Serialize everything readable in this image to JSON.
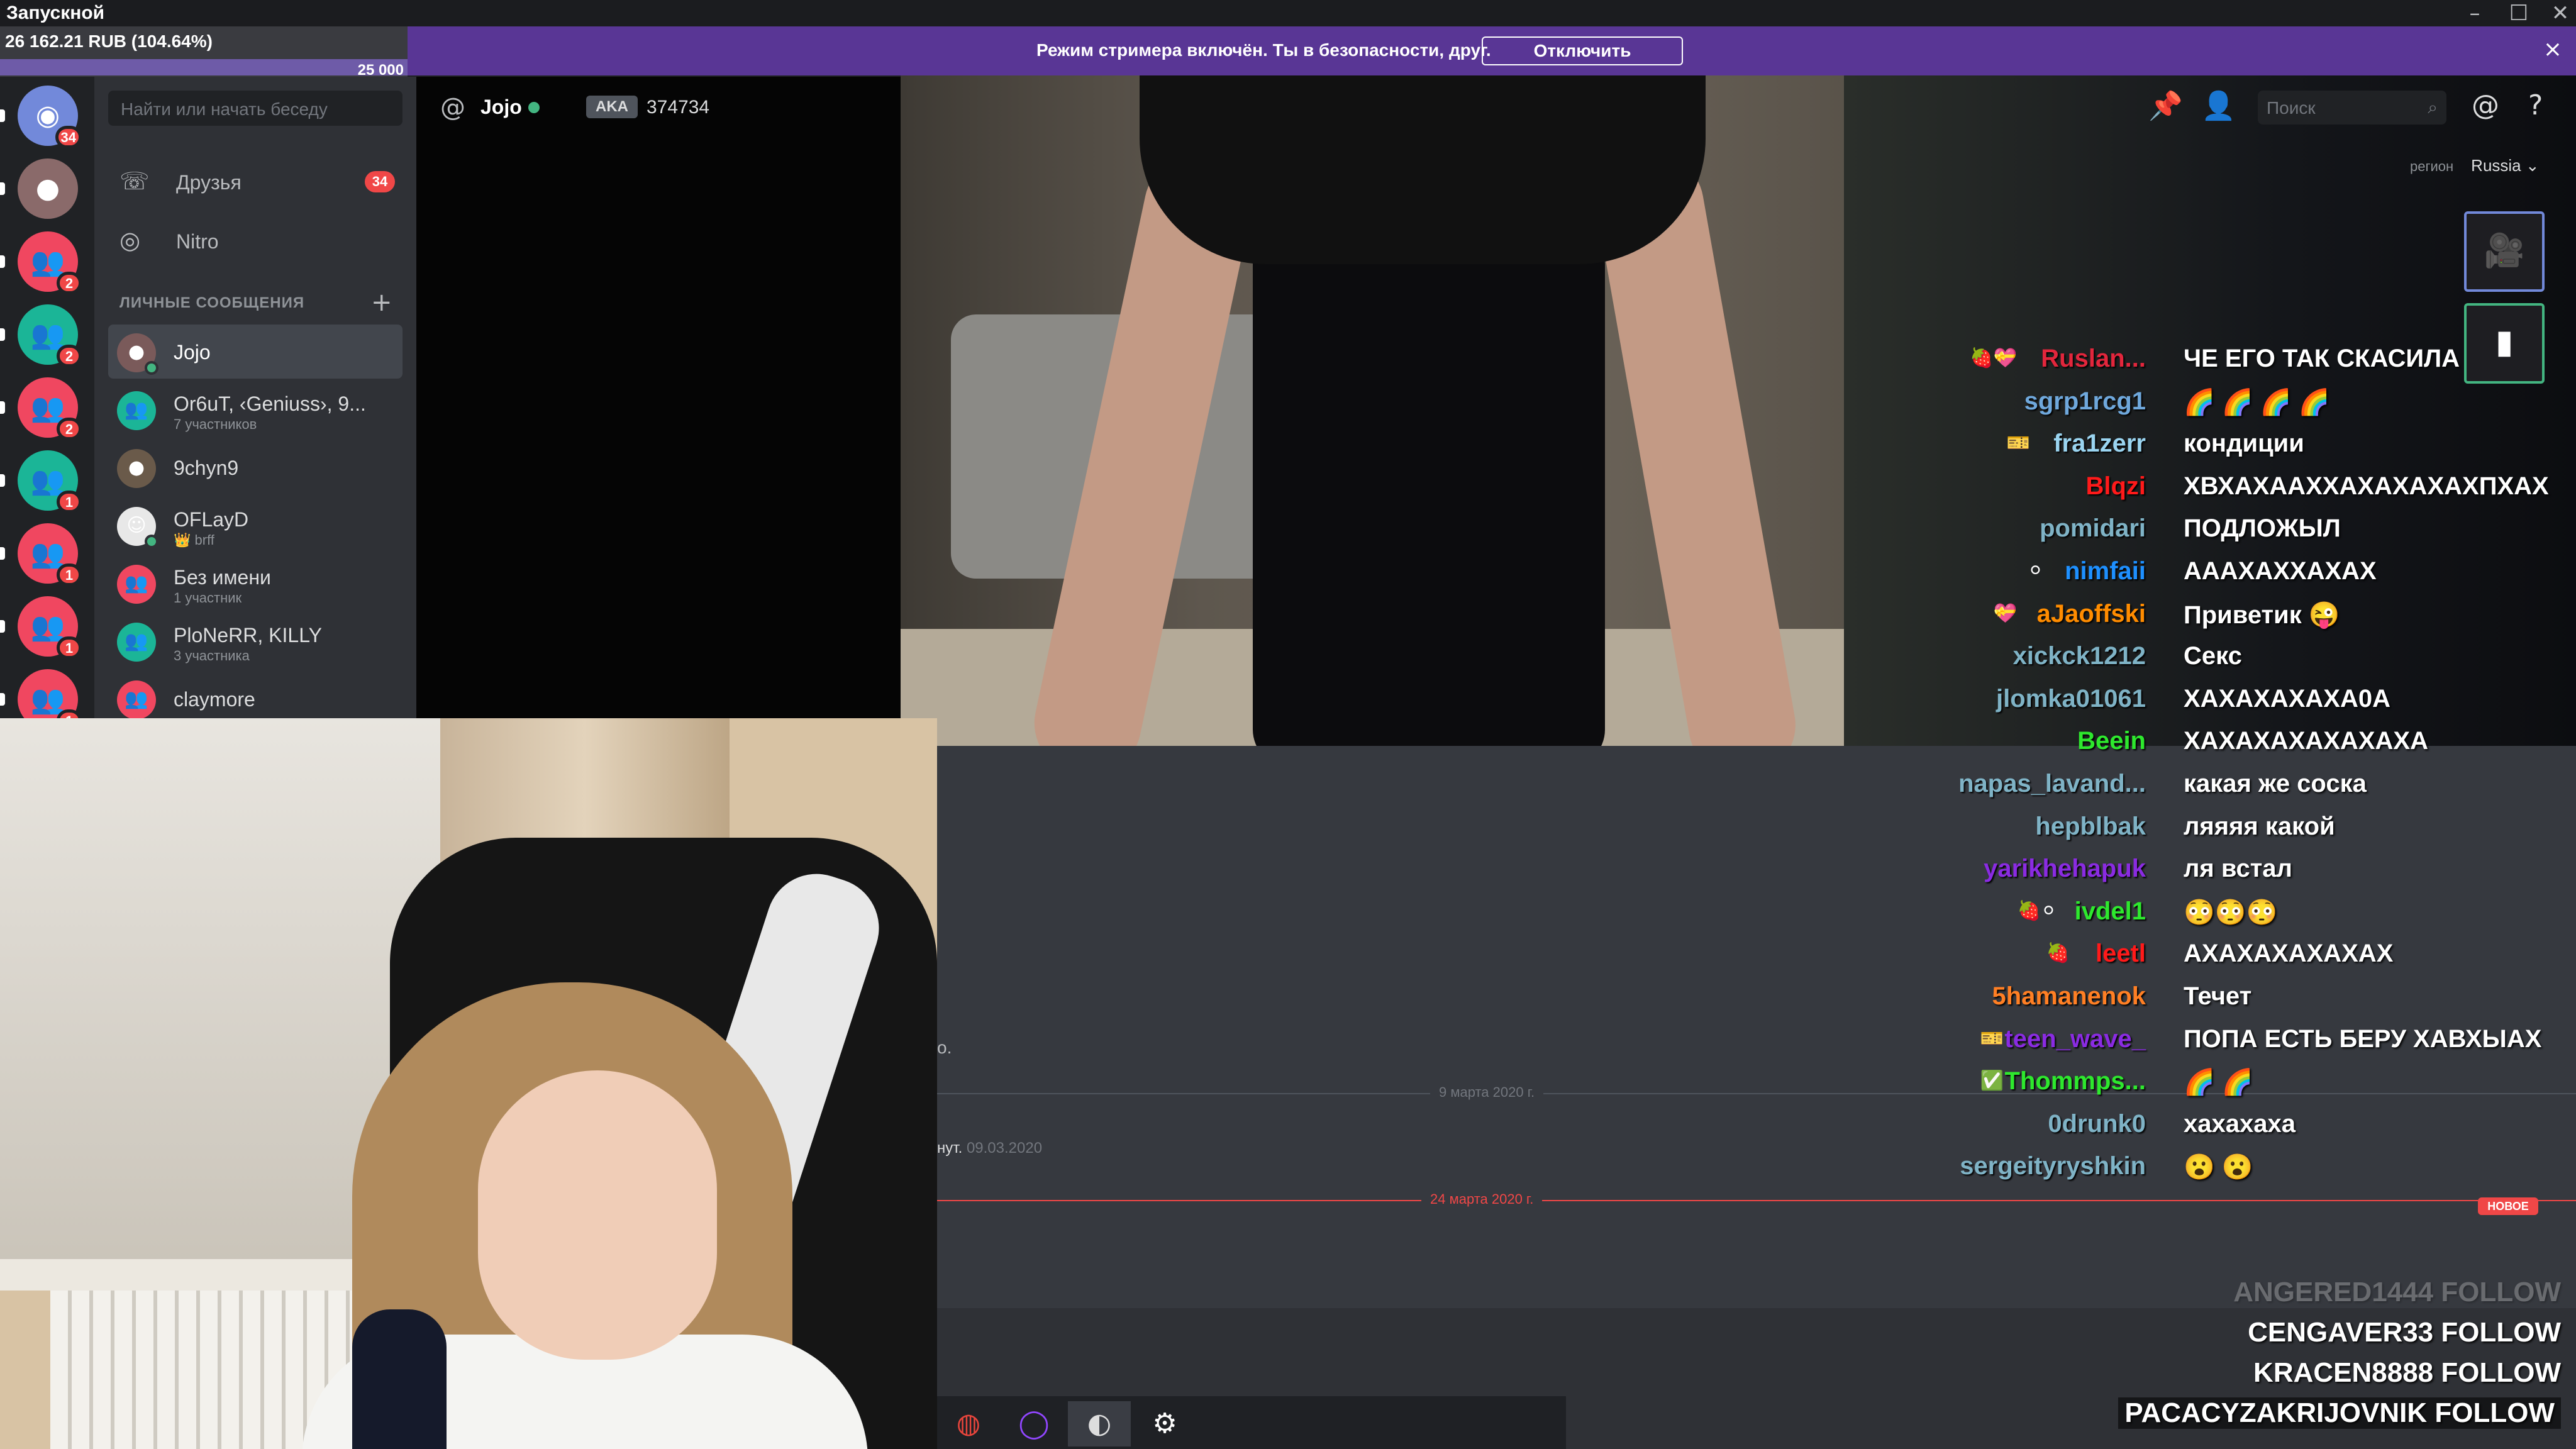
{
  "window": {
    "title": "Запускной",
    "controls": [
      "–",
      "☐",
      "✕"
    ]
  },
  "money_overlay": {
    "text": "26 162.21 RUB (104.64%)",
    "goal": "25 000",
    "progress_fraction": 1.0
  },
  "banner": {
    "message": "Режим стримера включён. Ты в безопасности, друг.",
    "button_label": "Отключить",
    "close_glyph": "×",
    "color": "#593695"
  },
  "servers": [
    {
      "badge": "34",
      "color": "#7289da",
      "icon": "discord-home-icon",
      "glyph": "◉"
    },
    {
      "badge": "",
      "color": "#8a6a6a",
      "icon": "avatar-pig-icon",
      "glyph": "●"
    },
    {
      "badge": "2",
      "color": "#f04760",
      "icon": "group-dm-icon",
      "glyph": "👥"
    },
    {
      "badge": "2",
      "color": "#1bb597",
      "icon": "group-dm-icon",
      "glyph": "👥"
    },
    {
      "badge": "2",
      "color": "#f04760",
      "icon": "group-dm-icon",
      "glyph": "👥"
    },
    {
      "badge": "1",
      "color": "#1bb597",
      "icon": "group-dm-icon",
      "glyph": "👥"
    },
    {
      "badge": "1",
      "color": "#f04760",
      "icon": "group-dm-icon",
      "glyph": "👥"
    },
    {
      "badge": "1",
      "color": "#f04760",
      "icon": "group-dm-icon",
      "glyph": "👥"
    },
    {
      "badge": "1",
      "color": "#f04760",
      "icon": "group-dm-icon",
      "glyph": "👥"
    }
  ],
  "sidebar": {
    "search_placeholder": "Найти или начать беседу",
    "friends": {
      "label": "Друзья",
      "badge": "34",
      "icon": "friends-icon",
      "glyph": "☏"
    },
    "nitro": {
      "label": "Nitro",
      "icon": "nitro-icon",
      "glyph": "◎"
    },
    "section_title": "ЛИЧНЫЕ СООБЩЕНИЯ",
    "add_glyph": "+",
    "dms": [
      {
        "name": "Jojo",
        "sub": "",
        "color": "#7a5a5a",
        "glyph": "●",
        "active": true,
        "online": true
      },
      {
        "name": "Or6uT, ‹Geniuss›, 9...",
        "sub": "7 участников",
        "color": "#1bb597",
        "glyph": "👥",
        "active": false,
        "online": false
      },
      {
        "name": "9chyn9",
        "sub": "",
        "color": "#6a5a4a",
        "glyph": "●",
        "active": false,
        "online": false
      },
      {
        "name": "OFLayD",
        "sub": "👑 brff",
        "color": "#e8e8e8",
        "glyph": "☺",
        "active": false,
        "online": true
      },
      {
        "name": "Без имени",
        "sub": "1 участник",
        "color": "#f04760",
        "glyph": "👥",
        "active": false,
        "online": false
      },
      {
        "name": "PloNeRR, KILLY",
        "sub": "3 участника",
        "color": "#1bb597",
        "glyph": "👥",
        "active": false,
        "online": false
      },
      {
        "name": "claymore",
        "sub": "",
        "color": "#f04760",
        "glyph": "👥",
        "active": false,
        "online": false
      }
    ]
  },
  "channel_header": {
    "at_glyph": "@",
    "name": "Jojo",
    "aka_label": "AKA",
    "aka_value": "374734"
  },
  "toolbar": {
    "search_placeholder": "Поиск",
    "search_glyph": "⌕",
    "pin_glyph": "📌",
    "add_friend_glyph": "👤",
    "mention_glyph": "@",
    "help_glyph": "?",
    "region_label": "регион",
    "region_value": "Russia ⌄",
    "video_glyph": "🎥",
    "stream_thumb_glyph": "▮"
  },
  "chat_area": {
    "fragment1": "о.",
    "fragment2_name": "нут.",
    "fragment2_date": "09.03.2020",
    "divider1": "9 марта 2020 г.",
    "divider2": "24 марта 2020 г.",
    "new_tag": "НОВОЕ"
  },
  "stream_chat": [
    {
      "user": "Ruslan...",
      "color": "#e2263c",
      "badges": "🍓💝",
      "text": "ЧЕ ЕГО ТАК СКАСИЛА"
    },
    {
      "user": "sgrp1rcg1",
      "color": "#6fa8dc",
      "badges": "",
      "text": "🌈 🌈 🌈 🌈"
    },
    {
      "user": "fra1zerr",
      "color": "#9ad4f0",
      "badges": "🎫",
      "text": "кондиции"
    },
    {
      "user": "Blqzi",
      "color": "#ff1a1a",
      "badges": "",
      "text": "ХВХАХААХХАХАХАХАХПХАХ"
    },
    {
      "user": "pomidari",
      "color": "#7fb3c6",
      "badges": "",
      "text": "ПОДЛОЖЫЛ"
    },
    {
      "user": "nimfaii",
      "color": "#1e90ff",
      "badges": "⚪",
      "text": "АААХАХХАХАХ"
    },
    {
      "user": "aJaoffski",
      "color": "#ff8c00",
      "badges": "💝",
      "text": "Приветик 😜"
    },
    {
      "user": "xickck1212",
      "color": "#7fb3c6",
      "badges": "",
      "text": "Секс"
    },
    {
      "user": "jlomka01061",
      "color": "#7fb3c6",
      "badges": "",
      "text": "ХАХАХАХАХА0А"
    },
    {
      "user": "Beein",
      "color": "#2ee82e",
      "badges": "",
      "text": "ХАХАХАХАХАХАХА"
    },
    {
      "user": "napas_lavand...",
      "color": "#7fb3c6",
      "badges": "",
      "text": "какая же соска"
    },
    {
      "user": "hepblbak",
      "color": "#7fb3c6",
      "badges": "",
      "text": "ляяяя какой"
    },
    {
      "user": "yarikhehapuk",
      "color": "#8a2be2",
      "badges": "",
      "text": "ля встал"
    },
    {
      "user": "ivdel1",
      "color": "#2ee82e",
      "badges": "🍓⚪",
      "text": "😳😳😳"
    },
    {
      "user": "leetl",
      "color": "#ff1a1a",
      "badges": "🍓",
      "text": "АХАХАХАХАХАХ"
    },
    {
      "user": "5hamanenok",
      "color": "#ff7f24",
      "badges": "",
      "text": "Течет"
    },
    {
      "user": "teen_wave_",
      "color": "#8a2be2",
      "badges": "🎫",
      "text": "ПОПА ЕСТЬ БЕРУ ХАВХЫАХ"
    },
    {
      "user": "Thommps...",
      "color": "#2ee82e",
      "badges": "✅",
      "text": "🌈 🌈"
    },
    {
      "user": "0drunk0",
      "color": "#7fb3c6",
      "badges": "",
      "text": "хахахаха"
    },
    {
      "user": "sergeityryshkin",
      "color": "#7fb3c6",
      "badges": "",
      "text": "😮 😮"
    }
  ],
  "follows": [
    {
      "text": "ANGERED1444  FOLLOW",
      "style": "faded"
    },
    {
      "text": "CENGAVER33  FOLLOW",
      "style": "plain"
    },
    {
      "text": "KRACEN8888  FOLLOW",
      "style": "plain"
    },
    {
      "text": "PACACYZAKRIJOVNIK  FOLLOW",
      "style": "hl"
    }
  ],
  "taskbar": [
    {
      "icon": "chrome-icon",
      "glyph": "◍",
      "color": "#e8453c"
    },
    {
      "icon": "obs-purple-icon",
      "glyph": "◯",
      "color": "#9146ff"
    },
    {
      "icon": "obs-studio-icon",
      "glyph": "◐",
      "color": "#dddddd"
    },
    {
      "icon": "settings-gear-icon",
      "glyph": "⚙",
      "color": "#ffffff"
    }
  ]
}
